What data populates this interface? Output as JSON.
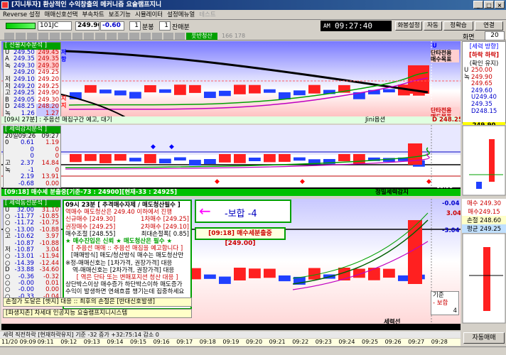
{
  "window": {
    "title": "[지니투자] 환상적인 수익창출의 메커니즘 요술램프지니"
  },
  "menu": [
    "Reverse 설정",
    "매매신호선택",
    "부속차트",
    "보조기능",
    "시뮬레이터",
    "설정메뉴얼",
    "테스트"
  ],
  "toolbar": {
    "code": "101JC",
    "price": "249.90",
    "change": "-0.60",
    "interval": "1",
    "interval_unit": "분봉",
    "count": "1",
    "count_unit": "잔매분",
    "clock": "09:27:40",
    "btn_screen": "화봉설정",
    "btn_auto": "자동",
    "btn_adjust": "정확습",
    "btn_connect": "연결",
    "screen_label": "화면",
    "screen_value": "20"
  },
  "toolbar2": {
    "active_tab": "풋반청산",
    "counter": "166 178"
  },
  "futures": {
    "header": "[ 선물지수분석 ]",
    "rows": [
      {
        "l": "U",
        "a": "249.50",
        "b": "249.45"
      },
      {
        "l": "A",
        "a": "249.35",
        "b": "249.35"
      },
      {
        "l": "녹",
        "a": "249.30",
        "b": "249.30"
      },
      {
        "l": "",
        "a": "249.20",
        "b": "249.25"
      },
      {
        "l": "저",
        "a": "249.10",
        "b": "249.20"
      },
      {
        "l": "저",
        "a": "249.20",
        "b": "249.25"
      },
      {
        "l": "고",
        "a": "249.25",
        "b": "249.90"
      },
      {
        "l": "B",
        "a": "249.05",
        "b": "249.30"
      },
      {
        "l": "D",
        "a": "248.25",
        "b": "248.20"
      },
      {
        "l": "녹",
        "a": "1.26",
        "b": "1.27"
      }
    ],
    "tag_top": "저항",
    "tag_bot": "지지"
  },
  "right_labels": {
    "u_line": "U 249.40",
    "p1a": "단타전용",
    "p1b": "매수목표",
    "p2a": "단타전용",
    "p2b": "매도목표",
    "d_line": "D 248.25"
  },
  "band1": {
    "left": "[09시 27분] : 주음선 매집구간 예고, 대기",
    "right": "Jini옵션"
  },
  "force": {
    "header": "[ 세력강지분석 ]",
    "r1": [
      "20일09:26",
      "09:27"
    ],
    "rows": [
      [
        "0",
        "0.61",
        "1.19"
      ],
      [
        "",
        "0",
        "0"
      ],
      [
        "",
        "0",
        "0"
      ],
      [
        "고",
        "2.37",
        "14.84"
      ],
      [
        "녹",
        "-1",
        "0"
      ],
      [
        "",
        "2.19",
        "13.91"
      ],
      [
        "",
        "-0.68",
        "0.00"
      ]
    ]
  },
  "band2": {
    "left": "[09:18] 매수세 분출중[기준-73 : 24900][현재-33 : 24925]",
    "right": "정밀세력감지",
    "value": "13.91"
  },
  "sig": {
    "header": "[ 세력동선분석 ]",
    "rows": [
      [
        "U",
        "32.00",
        "31.10"
      ],
      [
        "○",
        "-11.77",
        "-10.85"
      ],
      [
        "○",
        "-11.72",
        "-10.75"
      ],
      [
        "○",
        "-13.00",
        "-10.88"
      ],
      [
        "고",
        "-10.62",
        "3.97"
      ],
      [
        "",
        "-10.87",
        "-10.88"
      ],
      [
        "저",
        "-10.87",
        "3.04"
      ],
      [
        "○",
        "-13.01",
        "-11.94"
      ],
      [
        "○",
        "-14.39",
        "-12.44"
      ],
      [
        "D",
        "-33.88",
        "-34.60"
      ],
      [
        "○",
        "-0.36",
        "-0.32"
      ],
      [
        "○",
        "-0.00",
        "0.01"
      ],
      [
        "○",
        "-0.00",
        "0.00"
      ],
      [
        "○",
        "-0.33",
        "-0.04"
      ]
    ]
  },
  "mid": {
    "h1": "09시 23분 [ 추격매수자제 / 매도청산필수 ]",
    "h2": "역매수 매도청산은 249.40 이하에서 진행",
    "l1": "신규매수 [249.30]",
    "l2": "권장매수 [249.25]",
    "r1": "1차매수 [249.25]",
    "r2": "2차매수 [249.10]",
    "l3": "매수조절 [248.55]",
    "r3": "최대손절폭[ 0.85]",
    "mark": "★ 매수진입은 신뢰 ★ 매도청산은 필수 ★",
    "b1": "[ 주음선 매매 :: 주음선 매집을 예고합니다 ]",
    "b2": "[매매방식] 매도/청산방식 매수는 매도청산만",
    "b3": "※정-매매신호는 [1차가격, 권장가격] 대응",
    "b4": "역-매매신호는 [2차가격, 권장가격] 대응",
    "b5": "[ 역은 단타 또는 변매포지션 청산 대응 ]",
    "b6": "상단박스이상 매수증가 하단박스이하 매도증가",
    "b7": "수익이 발생하면 연쇄흐름 챙기는데 집중하세요",
    "footer1": "손절가 도달은 [헷지] 대응 :: 최후의 손절은 [반대신호발생]",
    "footer2": "[파생지존] 차세대 인공지능 요술램프지니시스템"
  },
  "bohap": {
    "arrow": "←",
    "text": "-보합 -4"
  },
  "signal_box": "[09:18] 매수세분출중[249.00]",
  "sig_right": {
    "v1": "-0.04",
    "v2": "3.04",
    "v3": "-3.04",
    "bottom": "세력선",
    "kijun": "기준",
    "bohap2": "- 보합",
    "val4": "4"
  },
  "right_panel": {
    "title1": "[세력 방향]",
    "dir": "[하락 하락]",
    "sub": "(확인 유지)",
    "vals": [
      {
        "k": "U",
        "v": "250.00"
      },
      {
        "k": "녹",
        "v": "249.90"
      },
      {
        "k": "",
        "v": "249.65"
      },
      {
        "k": "",
        "v": "249.60"
      },
      {
        "k": "",
        "v": "U249.40"
      },
      {
        "k": "",
        "v": "249.35"
      },
      {
        "k": "",
        "v": "D248.15"
      }
    ],
    "price_tag": "249.90",
    "up": "매수 249.30",
    "hi": "매수249.15",
    "stop": "손절 248.60",
    "avg": "평균 249.25",
    "auto": "자동매매"
  },
  "statusbar": {
    "text": "세력 직전하락 [현재하락유지] 기준 -32 증가 +32:75:14 감소 0"
  },
  "timeline": [
    "11/20 09:09",
    "09:11",
    "09:12",
    "09:13",
    "09:14",
    "09:15",
    "09:16",
    "09:17",
    "09:18",
    "09:19",
    "09:20",
    "09:21",
    "09:22",
    "09:23",
    "09:24",
    "09:25",
    "09:26",
    "09:27",
    "09:28"
  ],
  "colors": {
    "panel_bg": "#000000",
    "green_band": "#00c000",
    "red_bar": "#ff2020",
    "blue_bar": "#2040ff"
  }
}
